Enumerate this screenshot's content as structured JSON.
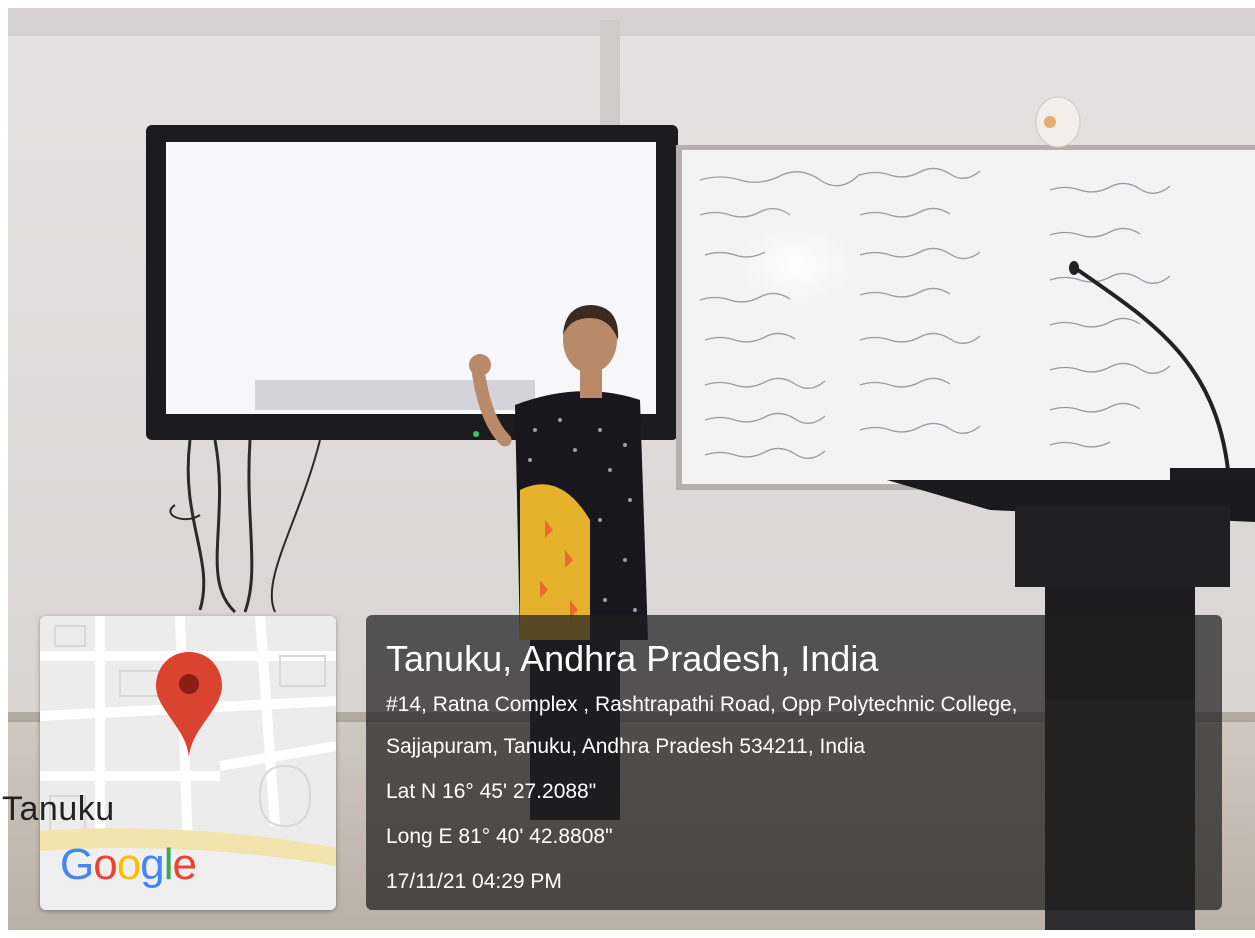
{
  "map": {
    "town_label": "Tanuku",
    "google_logo": {
      "letters": [
        "G",
        "o",
        "o",
        "g",
        "l",
        "e"
      ],
      "colors": [
        "#4285F4",
        "#EA4335",
        "#FBBC05",
        "#4285F4",
        "#34A853",
        "#EA4335"
      ]
    },
    "pin_color": "#D9432F"
  },
  "location": {
    "title": "Tanuku, Andhra Pradesh, India",
    "address_line1": "#14, Ratna Complex , Rashtrapathi Road, Opp Polytechnic College,",
    "address_line2": "Sajjapuram, Tanuku, Andhra Pradesh 534211, India",
    "latitude": "Lat N 16° 45' 27.2088\"",
    "longitude": "Long E 81° 40' 42.8808\"",
    "timestamp": "17/11/21 04:29 PM"
  }
}
